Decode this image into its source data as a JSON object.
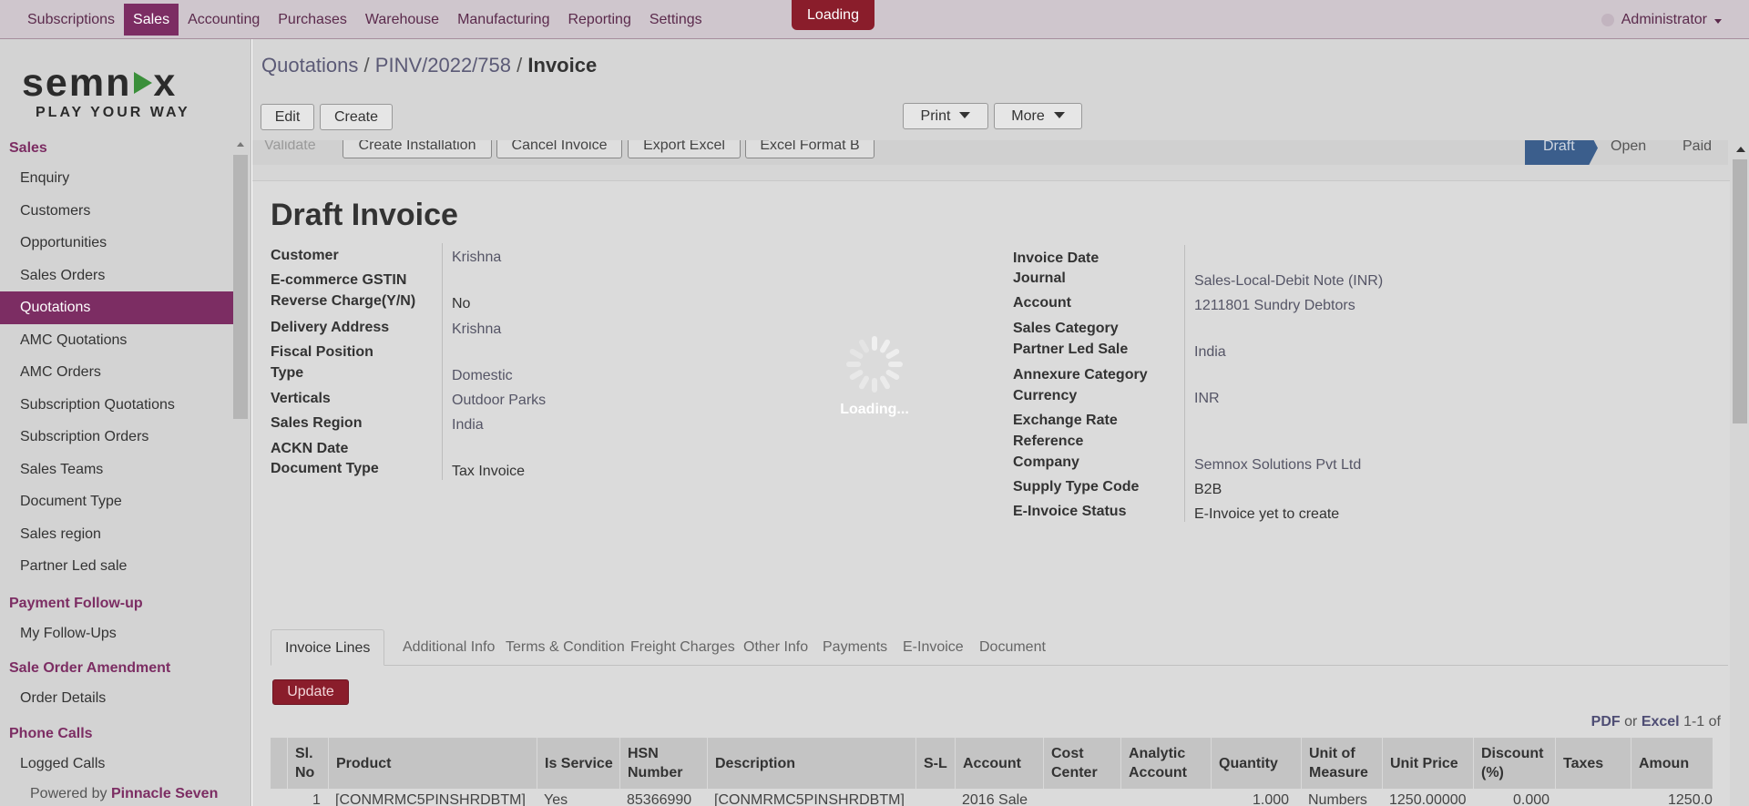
{
  "topbar": {
    "menu": [
      "Subscriptions",
      "Sales",
      "Accounting",
      "Purchases",
      "Warehouse",
      "Manufacturing",
      "Reporting",
      "Settings"
    ],
    "active": "Sales",
    "loading_badge": "Loading",
    "user": "Administrator"
  },
  "sidebar": {
    "logo_main": "semn",
    "logo_main_end": "x",
    "logo_sub": "PLAY YOUR WAY",
    "sections": [
      {
        "header": "Sales",
        "items": [
          "Enquiry",
          "Customers",
          "Opportunities",
          "Sales Orders",
          "Quotations",
          "AMC Quotations",
          "AMC Orders",
          "Subscription Quotations",
          "Subscription Orders",
          "Sales Teams",
          "Document Type",
          "Sales region",
          "Partner Led sale"
        ]
      },
      {
        "header": "Payment Follow-up",
        "items": [
          "My Follow-Ups"
        ]
      },
      {
        "header": "Sale Order Amendment",
        "items": [
          "Order Details"
        ]
      },
      {
        "header": "Phone Calls",
        "items": [
          "Logged Calls"
        ]
      }
    ],
    "active_item": "Quotations",
    "powered_prefix": "Powered by",
    "powered_brand": "Pinnacle Seven"
  },
  "header": {
    "crumb1": "Quotations",
    "sep": "/",
    "crumb2": "PINV/2022/758",
    "current": "Invoice",
    "edit_label": "Edit",
    "create_label": "Create",
    "print_label": "Print",
    "more_label": "More"
  },
  "statusbar": {
    "buttons": [
      "Validate",
      "Create Installation",
      "Cancel Invoice",
      "Export Excel",
      "Excel Format B"
    ],
    "stages": [
      "Draft",
      "Open",
      "Paid"
    ]
  },
  "form": {
    "title": "Draft Invoice",
    "left": [
      {
        "label": "Customer",
        "value": "Krishna"
      },
      {
        "label": "E-commerce GSTIN",
        "value": ""
      },
      {
        "label": "Reverse Charge(Y/N)",
        "value": "No"
      },
      {
        "label": "Delivery Address",
        "value": "Krishna"
      },
      {
        "label": "Fiscal Position",
        "value": ""
      },
      {
        "label": "Type",
        "value": "Domestic"
      },
      {
        "label": "Verticals",
        "value": "Outdoor Parks"
      },
      {
        "label": "Sales Region",
        "value": "India"
      },
      {
        "label": "ACKN Date",
        "value": ""
      },
      {
        "label": "Document Type",
        "value": "Tax Invoice"
      }
    ],
    "right": [
      {
        "label": "Invoice Date",
        "value": ""
      },
      {
        "label": "Journal",
        "value": "Sales-Local-Debit Note (INR)"
      },
      {
        "label": "Account",
        "value": "1211801 Sundry Debtors"
      },
      {
        "label": "Sales Category",
        "value": ""
      },
      {
        "label": "Partner Led Sale",
        "value": "India"
      },
      {
        "label": "Annexure Category",
        "value": ""
      },
      {
        "label": "Currency",
        "value": "INR"
      },
      {
        "label": "Exchange Rate",
        "value": ""
      },
      {
        "label": "Reference",
        "value": ""
      },
      {
        "label": "Company",
        "value": "Semnox Solutions Pvt Ltd"
      },
      {
        "label": "Supply Type Code",
        "value": "B2B"
      },
      {
        "label": "E-Invoice Status",
        "value": "E-Invoice yet to create"
      }
    ]
  },
  "tabs": [
    "Invoice Lines",
    "Additional Info",
    "Terms & Condition",
    "Freight Charges",
    "Other Info",
    "Payments",
    "E-Invoice",
    "Document"
  ],
  "update_label": "Update",
  "export": {
    "pdf": "PDF",
    "or": "or",
    "excel": "Excel",
    "count": "1-1 of"
  },
  "table": {
    "columns": [
      "Sl. No",
      "Product",
      "Is Service",
      "HSN Number",
      "Description",
      "S-L",
      "Account",
      "Cost Center",
      "Analytic Account",
      "Quantity",
      "Unit of Measure",
      "Unit Price",
      "Discount (%)",
      "Taxes",
      "Amoun"
    ],
    "row": [
      "1",
      "[CONMRMC5PINSHRDBTM]",
      "Yes",
      "85366990",
      "[CONMRMC5PINSHRDBTM]",
      "",
      "2016 Sale",
      "",
      "",
      "1.000",
      "Numbers",
      "1250.00000",
      "0.000",
      "",
      "1250.0"
    ]
  },
  "overlay": {
    "text": "Loading..."
  }
}
